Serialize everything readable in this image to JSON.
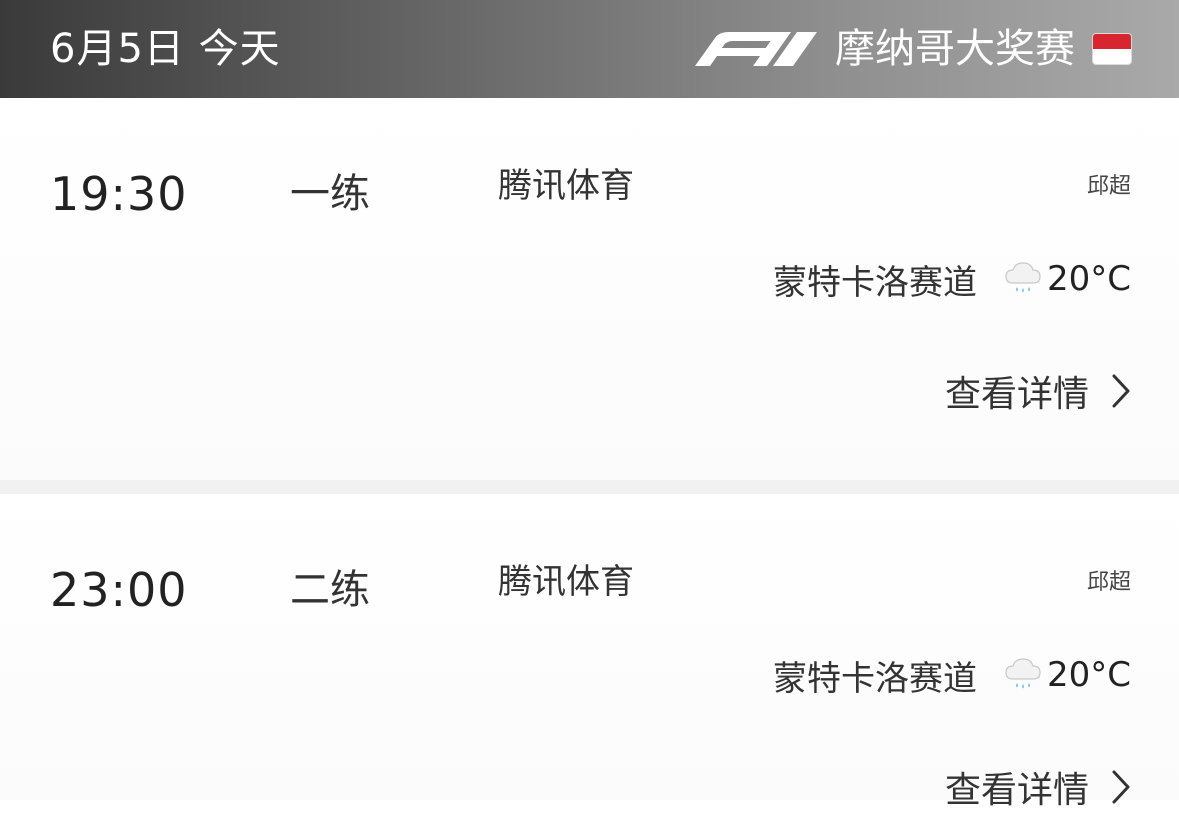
{
  "header": {
    "date_label": "6月5日 今天",
    "gp_name": "摩纳哥大奖赛",
    "logo_icon": "f1-logo",
    "flag_icon": "monaco-flag",
    "flag_colors": {
      "top": "#d7262f",
      "bottom": "#ffffff"
    }
  },
  "sessions": [
    {
      "time": "19:30",
      "type": "一练",
      "broadcaster": "腾讯体育",
      "commentator": "邱超",
      "venue": "蒙特卡洛赛道",
      "weather_icon": "rain-cloud-icon",
      "temperature": "20°C",
      "details_label": "查看详情"
    },
    {
      "time": "23:00",
      "type": "二练",
      "broadcaster": "腾讯体育",
      "commentator": "邱超",
      "venue": "蒙特卡洛赛道",
      "weather_icon": "rain-cloud-icon",
      "temperature": "20°C",
      "details_label": "查看详情"
    }
  ]
}
